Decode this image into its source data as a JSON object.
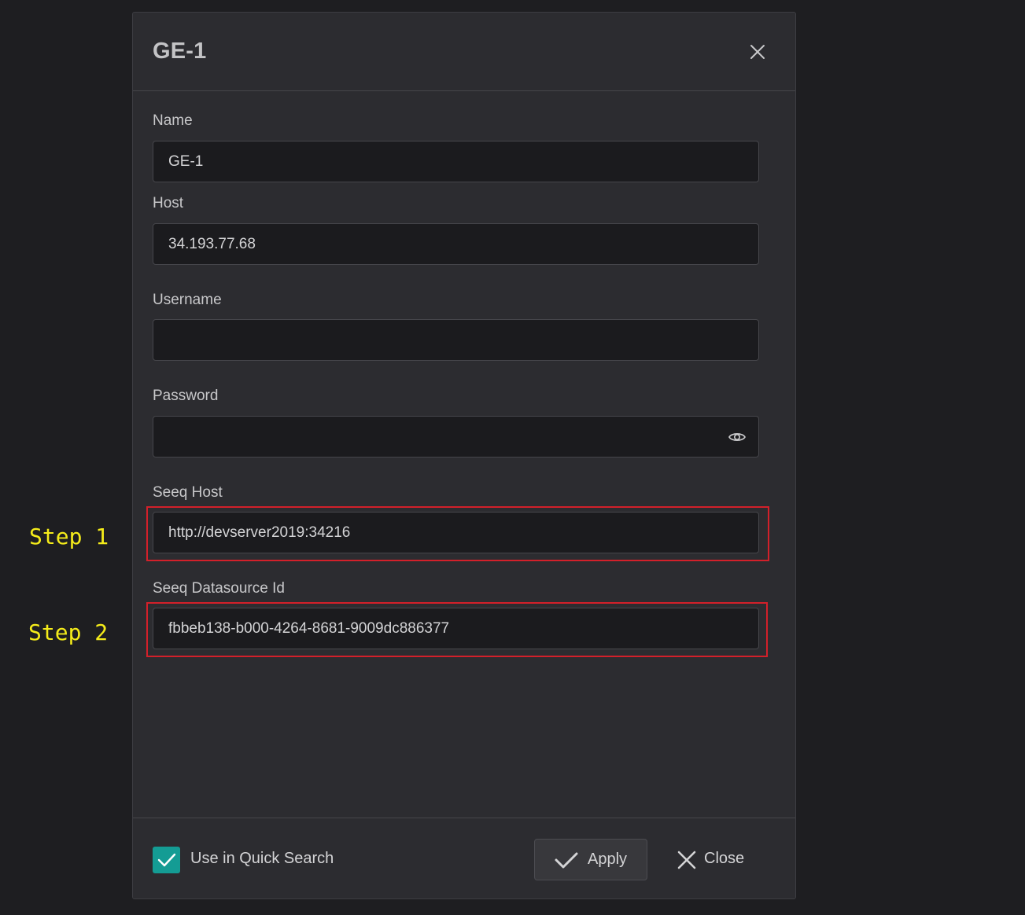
{
  "dialog": {
    "title": "GE-1"
  },
  "fields": {
    "name": {
      "label": "Name",
      "value": "GE-1"
    },
    "host": {
      "label": "Host",
      "value": "34.193.77.68"
    },
    "username": {
      "label": "Username",
      "value": ""
    },
    "password": {
      "label": "Password",
      "value": ""
    },
    "seeq_host": {
      "label": "Seeq Host",
      "value": "http://devserver2019:34216"
    },
    "seeq_datasource_id": {
      "label": "Seeq Datasource Id",
      "value": "fbbeb138-b000-4264-8681-9009dc886377"
    }
  },
  "annotations": {
    "step1": "Step 1",
    "step2": "Step 2",
    "highlight_color": "#d3202a",
    "step_color": "#f5ec1a"
  },
  "footer": {
    "quick_search_label": "Use in Quick Search",
    "quick_search_checked": true,
    "apply_label": "Apply",
    "close_label": "Close"
  },
  "icons": {
    "close": "close-icon",
    "eye": "eye-icon",
    "check": "check-icon",
    "checkbox": "checkmark-icon"
  },
  "colors": {
    "accent": "#149c94",
    "background": "#1e1e21",
    "dialog": "#2c2c30",
    "input": "#1b1b1e"
  }
}
